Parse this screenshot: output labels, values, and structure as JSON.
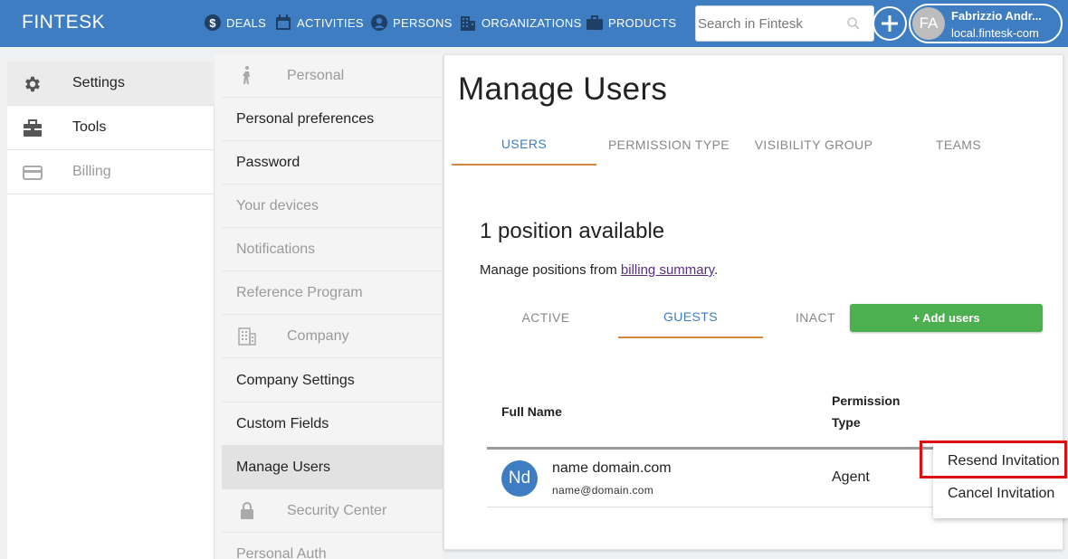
{
  "app": {
    "brand": "FINTESK"
  },
  "topnav": {
    "items": [
      {
        "label": "DEALS",
        "icon": "dollar-icon"
      },
      {
        "label": "ACTIVITIES",
        "icon": "calendar-icon"
      },
      {
        "label": "PERSONS",
        "icon": "person-icon"
      },
      {
        "label": "ORGANIZATIONS",
        "icon": "building-icon"
      },
      {
        "label": "PRODUCTS",
        "icon": "briefcase-icon"
      }
    ],
    "search_placeholder": "Search in Fintesk",
    "profile": {
      "initials": "FA",
      "name": "Fabrizzio Andr...",
      "domain": "local.fintesk-com"
    }
  },
  "leftcol": {
    "items": [
      {
        "label": "Settings",
        "icon": "gear-icon",
        "active": true
      },
      {
        "label": "Tools",
        "icon": "toolbox-icon"
      },
      {
        "label": "Billing",
        "icon": "credit-card-icon",
        "disabled": true
      }
    ]
  },
  "midcol": {
    "items": [
      {
        "label": "Personal",
        "type": "header",
        "icon": "person-walking-icon"
      },
      {
        "label": "Personal preferences"
      },
      {
        "label": "Password"
      },
      {
        "label": "Your devices",
        "disabled": true
      },
      {
        "label": "Notifications",
        "disabled": true
      },
      {
        "label": "Reference Program",
        "disabled": true
      },
      {
        "label": "Company",
        "type": "header",
        "icon": "building-icon"
      },
      {
        "label": "Company Settings"
      },
      {
        "label": "Custom Fields"
      },
      {
        "label": "Manage Users",
        "active": true
      },
      {
        "label": "Security Center",
        "type": "header",
        "icon": "lock-icon"
      },
      {
        "label": "Personal Auth",
        "disabled": true
      }
    ]
  },
  "main": {
    "title": "Manage Users",
    "tabs": [
      {
        "label": "USERS",
        "active": true
      },
      {
        "label": "PERMISSION TYPE"
      },
      {
        "label": "VISIBILITY GROUP"
      },
      {
        "label": "TEAMS"
      }
    ],
    "positions": {
      "title": "1 position available",
      "sub_prefix": "Manage positions from ",
      "sub_link": "billing summary",
      "sub_suffix": "."
    },
    "subtabs": [
      {
        "label": "ACTIVE"
      },
      {
        "label": "GUESTS",
        "active": true
      },
      {
        "label": "INACT"
      }
    ],
    "add_button": "+ Add users",
    "table": {
      "headers": {
        "full_name": "Full Name",
        "permission_line1": "Permission",
        "permission_line2": "Type"
      },
      "rows": [
        {
          "initials": "Nd",
          "name": "name domain.com",
          "email": "name@domain.com",
          "type": "Agent"
        }
      ]
    }
  },
  "context_menu": {
    "items": [
      {
        "label": "Resend Invitation",
        "highlighted": true
      },
      {
        "label": "Cancel Invitation"
      }
    ]
  },
  "colors": {
    "brand": "#3e7dc2",
    "accent_underline": "#d7873b",
    "add_button": "#4caf50",
    "highlight": "#e01010",
    "link": "#5a2d82"
  }
}
